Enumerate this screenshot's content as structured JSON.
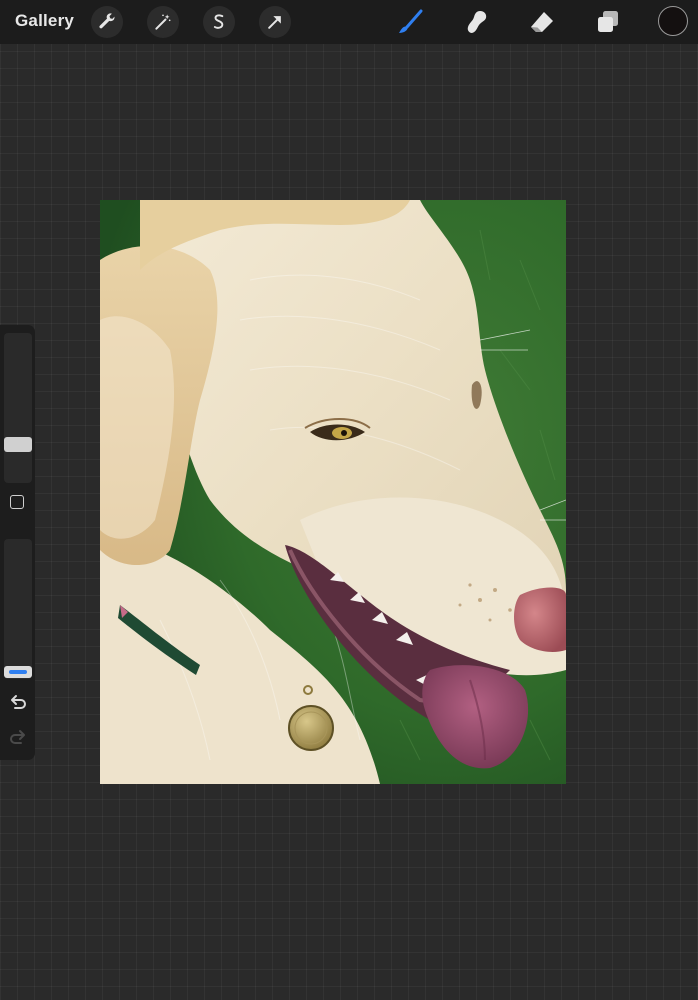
{
  "topbar": {
    "gallery_label": "Gallery",
    "left_tools": [
      "wrench-icon",
      "magic-wand-icon",
      "selection-s-icon",
      "transform-arrow-icon"
    ],
    "right_tools": [
      "brush-icon",
      "smudge-icon",
      "eraser-icon",
      "layers-icon"
    ],
    "active_tool": "brush-icon",
    "accent_color": "#2f7ff0",
    "current_color": "#141010"
  },
  "sidebar": {
    "brush_size_level": 0.26,
    "opacity_level": 0.02,
    "controls": [
      "modify-square-icon",
      "undo-icon",
      "redo-icon"
    ]
  },
  "canvas": {
    "artwork": "dog-portrait-painting"
  }
}
